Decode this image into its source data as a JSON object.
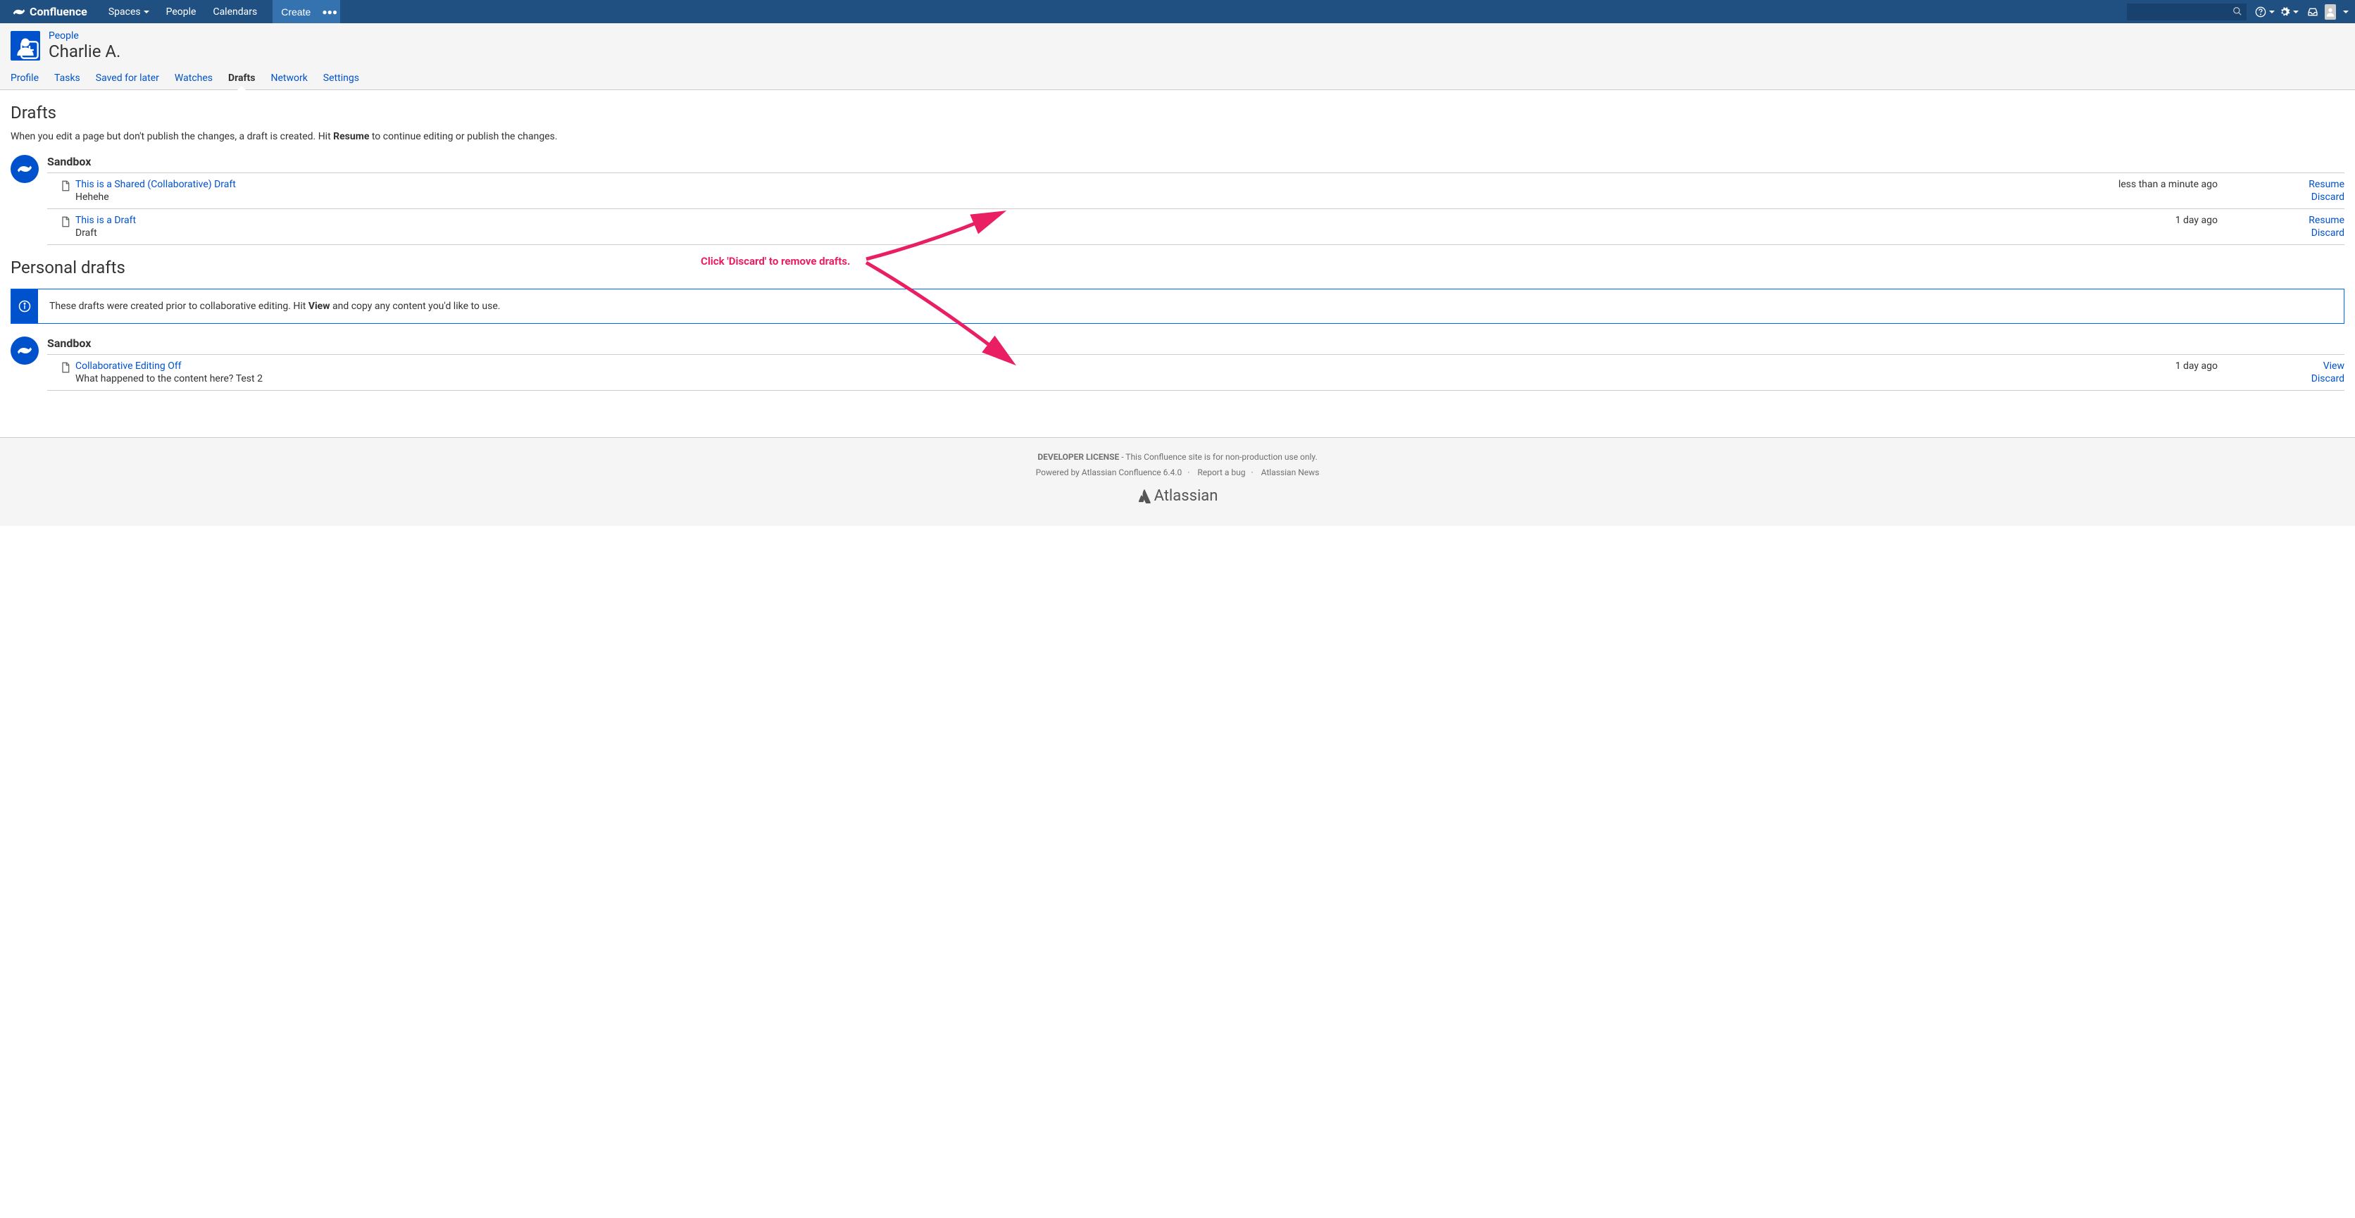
{
  "header": {
    "logo": "Confluence",
    "nav": {
      "spaces": "Spaces",
      "people": "People",
      "calendars": "Calendars"
    },
    "create": "Create"
  },
  "profile": {
    "breadcrumb": "People",
    "name": "Charlie A."
  },
  "tabs": {
    "profile": "Profile",
    "tasks": "Tasks",
    "saved": "Saved for later",
    "watches": "Watches",
    "drafts": "Drafts",
    "network": "Network",
    "settings": "Settings"
  },
  "drafts": {
    "heading": "Drafts",
    "desc_pre": "When you edit a page but don't publish the changes, a draft is created. Hit ",
    "desc_bold": "Resume",
    "desc_post": " to continue editing or publish the changes.",
    "space": "Sandbox",
    "items": [
      {
        "title": "This is a Shared (Collaborative) Draft",
        "sub": "Hehehe",
        "time": "less than a minute ago",
        "a1": "Resume",
        "a2": "Discard"
      },
      {
        "title": "This is a Draft",
        "sub": "Draft",
        "time": "1 day ago",
        "a1": "Resume",
        "a2": "Discard"
      }
    ]
  },
  "personal": {
    "heading": "Personal drafts",
    "info_pre": "These drafts were created prior to collaborative editing. Hit ",
    "info_bold": "View",
    "info_post": " and copy any content you'd like to use.",
    "space": "Sandbox",
    "items": [
      {
        "title": "Collaborative Editing Off",
        "sub": "What happened to the content here? Test 2",
        "time": "1 day ago",
        "a1": "View",
        "a2": "Discard"
      }
    ]
  },
  "annotation": {
    "text": "Click 'Discard' to remove drafts."
  },
  "footer": {
    "license_bold": "DEVELOPER LICENSE",
    "license_rest": " - This Confluence site is for non-production use only.",
    "powered": "Powered by Atlassian Confluence 6.4.0",
    "report": "Report a bug",
    "news": "Atlassian News",
    "brand": "Atlassian"
  }
}
